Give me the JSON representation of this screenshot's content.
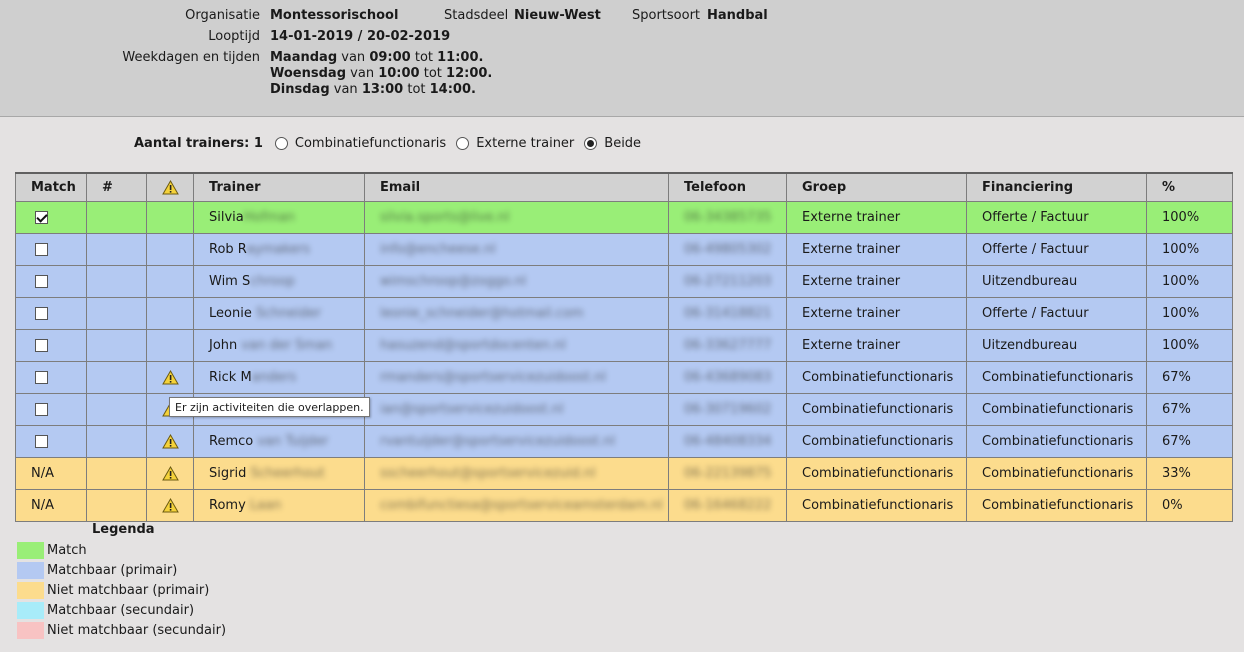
{
  "header": {
    "organisatie_label": "Organisatie",
    "organisatie": "Montessorischool",
    "stadsdeel_label": "Stadsdeel",
    "stadsdeel": "Nieuw-West",
    "sportsoort_label": "Sportsoort",
    "sportsoort": "Handbal",
    "looptijd_label": "Looptijd",
    "looptijd": "14-01-2019 / 20-02-2019",
    "weekdagen_label": "Weekdagen en tijden",
    "schedule": [
      {
        "day": "Maandag",
        "van": "van",
        "start": "09:00",
        "tot": "tot",
        "end": "11:00."
      },
      {
        "day": "Woensdag",
        "van": "van",
        "start": "10:00",
        "tot": "tot",
        "end": "12:00."
      },
      {
        "day": "Dinsdag",
        "van": "van",
        "start": "13:00",
        "tot": "tot",
        "end": "14:00."
      }
    ]
  },
  "filter": {
    "label": "Aantal trainers: 1",
    "options": [
      "Combinatiefunctionaris",
      "Externe trainer",
      "Beide"
    ],
    "selected": "Beide"
  },
  "table": {
    "columns": [
      "Match",
      "#",
      "warning-icon",
      "Trainer",
      "Email",
      "Telefoon",
      "Groep",
      "Financiering",
      "%"
    ],
    "headers": {
      "match": "Match",
      "num": "#",
      "trainer": "Trainer",
      "email": "Email",
      "telefoon": "Telefoon",
      "groep": "Groep",
      "financiering": "Financiering",
      "pct": "%"
    },
    "rows": [
      {
        "status": "match",
        "match": "checked",
        "warning": false,
        "trainer_first": "Silvia",
        "trainer_last": "Hofman",
        "email": "silvia.sports@live.nl",
        "telefoon": "06-34385735",
        "groep": "Externe trainer",
        "financiering": "Offerte / Factuur",
        "pct": "100%"
      },
      {
        "status": "primair",
        "match": "unchecked",
        "warning": false,
        "trainer_first": "Rob R",
        "trainer_last": "aymakers",
        "email": "info@encheese.nl",
        "telefoon": "06-49805302",
        "groep": "Externe trainer",
        "financiering": "Offerte / Factuur",
        "pct": "100%"
      },
      {
        "status": "primair",
        "match": "unchecked",
        "warning": false,
        "trainer_first": "Wim S",
        "trainer_last": "chroop",
        "email": "wimschroop@zoggo.nl",
        "telefoon": "06-27211203",
        "groep": "Externe trainer",
        "financiering": "Uitzendbureau",
        "pct": "100%"
      },
      {
        "status": "primair",
        "match": "unchecked",
        "warning": false,
        "trainer_first": "Leonie",
        "trainer_last": " Schneider",
        "email": "leonie_schneider@hotmail.com",
        "telefoon": "06-31418821",
        "groep": "Externe trainer",
        "financiering": "Offerte / Factuur",
        "pct": "100%"
      },
      {
        "status": "primair",
        "match": "unchecked",
        "warning": false,
        "trainer_first": "John",
        "trainer_last": " van der Sman",
        "email": "hasuzend@sportdocenten.nl",
        "telefoon": "06-33627777",
        "groep": "Externe trainer",
        "financiering": "Uitzendbureau",
        "pct": "100%"
      },
      {
        "status": "primair",
        "match": "unchecked",
        "warning": true,
        "trainer_first": "Rick M",
        "trainer_last": "anders",
        "email": "rmanders@sportservicezuidoost.nl",
        "telefoon": "06-43689083",
        "groep": "Combinatiefunctionaris",
        "financiering": "Combinatiefunctionaris",
        "pct": "67%"
      },
      {
        "status": "primair",
        "match": "unchecked",
        "warning": true,
        "trainer_first": "",
        "trainer_last": "",
        "email": "ian@sportservicezuidoost.nl",
        "telefoon": "06-30719602",
        "groep": "Combinatiefunctionaris",
        "financiering": "Combinatiefunctionaris",
        "pct": "67%"
      },
      {
        "status": "primair",
        "match": "unchecked",
        "warning": true,
        "trainer_first": "Remco",
        "trainer_last": " van Tuijder",
        "email": "rvantuijder@sportservicezuidoost.nl",
        "telefoon": "06-48408334",
        "groep": "Combinatiefunctionaris",
        "financiering": "Combinatiefunctionaris",
        "pct": "67%"
      },
      {
        "status": "niet-primair",
        "match": "N/A",
        "warning": true,
        "trainer_first": "Sigrid",
        "trainer_last": " Scheerhout",
        "email": "sscheerhout@sportservicezuid.nl",
        "telefoon": "06-22139875",
        "groep": "Combinatiefunctionaris",
        "financiering": "Combinatiefunctionaris",
        "pct": "33%"
      },
      {
        "status": "niet-primair",
        "match": "N/A",
        "warning": true,
        "trainer_first": "Romy",
        "trainer_last": " Laan",
        "email": "combifunctiesa@sportserviceamsterdam.nl",
        "telefoon": "06-16468222",
        "groep": "Combinatiefunctionaris",
        "financiering": "Combinatiefunctionaris",
        "pct": "0%"
      }
    ]
  },
  "tooltip": "Er zijn activiteiten die overlappen.",
  "legend": {
    "title": "Legenda",
    "items": [
      {
        "label": "Match",
        "color": "#99ee77"
      },
      {
        "label": "Matchbaar (primair)",
        "color": "#b4c9f2"
      },
      {
        "label": "Niet matchbaar (primair)",
        "color": "#fcdc8d"
      },
      {
        "label": "Matchbaar (secundair)",
        "color": "#a8ecf9"
      },
      {
        "label": "Niet matchbaar (secundair)",
        "color": "#f8c3c3"
      }
    ]
  },
  "colors": {
    "match": "#99ee77",
    "primair": "#b4c9f2",
    "niet-primair": "#fcdc8d",
    "warning": "#f5d23a"
  }
}
